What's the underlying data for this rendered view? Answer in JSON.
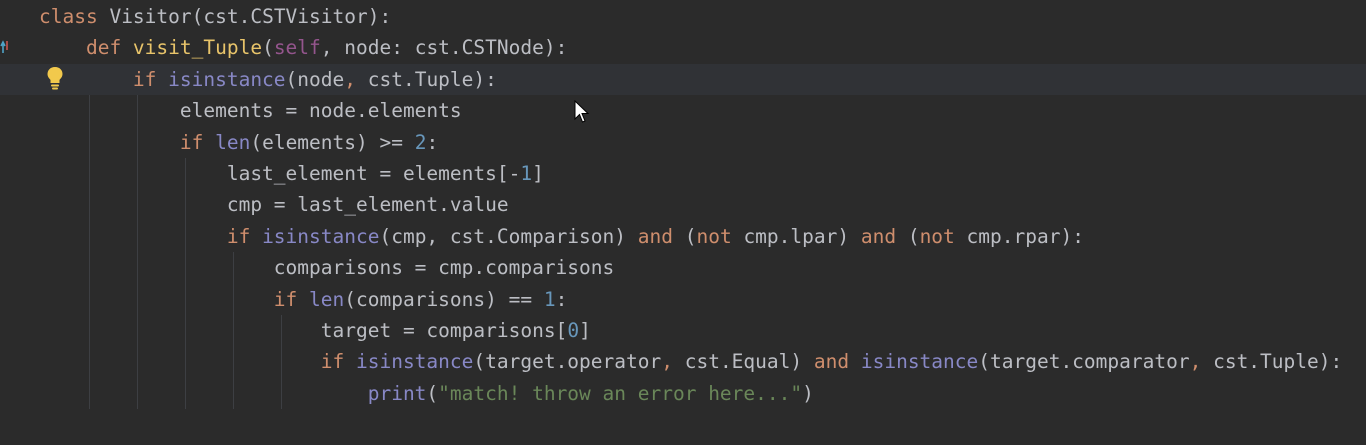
{
  "code": {
    "lines": [
      [
        {
          "t": "class ",
          "c": "kw"
        },
        {
          "t": "Visitor(cst.CSTVisitor):",
          "c": "txt"
        }
      ],
      [
        {
          "t": "    def ",
          "c": "kw"
        },
        {
          "t": "visit_Tuple",
          "c": "fn"
        },
        {
          "t": "(",
          "c": "txt"
        },
        {
          "t": "self",
          "c": "self"
        },
        {
          "t": ", node: cst.CSTNode):",
          "c": "txt"
        }
      ],
      [
        {
          "t": "        if ",
          "c": "kw"
        },
        {
          "t": "isinstance",
          "c": "bi"
        },
        {
          "t": "(node",
          "c": "txt"
        },
        {
          "t": ",",
          "c": "kw"
        },
        {
          "t": " cst.Tuple):",
          "c": "txt"
        }
      ],
      [
        {
          "t": "            elements = node.elements",
          "c": "txt"
        }
      ],
      [
        {
          "t": "            if ",
          "c": "kw"
        },
        {
          "t": "len",
          "c": "bi"
        },
        {
          "t": "(elements) >= ",
          "c": "txt"
        },
        {
          "t": "2",
          "c": "num"
        },
        {
          "t": ":",
          "c": "txt"
        }
      ],
      [
        {
          "t": "                last_element = elements[-",
          "c": "txt"
        },
        {
          "t": "1",
          "c": "num"
        },
        {
          "t": "]",
          "c": "txt"
        }
      ],
      [
        {
          "t": "                cmp = last_element.value",
          "c": "txt"
        }
      ],
      [
        {
          "t": "                if ",
          "c": "kw"
        },
        {
          "t": "isinstance",
          "c": "bi"
        },
        {
          "t": "(cmp, cst.Comparison) ",
          "c": "txt"
        },
        {
          "t": "and",
          "c": "kw"
        },
        {
          "t": " (",
          "c": "txt"
        },
        {
          "t": "not",
          "c": "kw"
        },
        {
          "t": " cmp.lpar) ",
          "c": "txt"
        },
        {
          "t": "and",
          "c": "kw"
        },
        {
          "t": " (",
          "c": "txt"
        },
        {
          "t": "not",
          "c": "kw"
        },
        {
          "t": " cmp.rpar):",
          "c": "txt"
        }
      ],
      [
        {
          "t": "                    comparisons = cmp.comparisons",
          "c": "txt"
        }
      ],
      [
        {
          "t": "                    if ",
          "c": "kw"
        },
        {
          "t": "len",
          "c": "bi"
        },
        {
          "t": "(comparisons) == ",
          "c": "txt"
        },
        {
          "t": "1",
          "c": "num"
        },
        {
          "t": ":",
          "c": "txt"
        }
      ],
      [
        {
          "t": "                        target = comparisons[",
          "c": "txt"
        },
        {
          "t": "0",
          "c": "num"
        },
        {
          "t": "]",
          "c": "txt"
        }
      ],
      [
        {
          "t": "                        if ",
          "c": "kw"
        },
        {
          "t": "isinstance",
          "c": "bi"
        },
        {
          "t": "(target.operator",
          "c": "txt"
        },
        {
          "t": ",",
          "c": "kw"
        },
        {
          "t": " cst.Equal) ",
          "c": "txt"
        },
        {
          "t": "and",
          "c": "kw"
        },
        {
          "t": " ",
          "c": "txt"
        },
        {
          "t": "isinstance",
          "c": "bi"
        },
        {
          "t": "(target.comparator",
          "c": "txt"
        },
        {
          "t": ",",
          "c": "kw"
        },
        {
          "t": " cst.Tuple):",
          "c": "txt"
        }
      ],
      [
        {
          "t": "                            print",
          "c": "bi"
        },
        {
          "t": "(",
          "c": "txt"
        },
        {
          "t": "\"match! throw an error here...\"",
          "c": "str"
        },
        {
          "t": ")",
          "c": "txt"
        }
      ]
    ],
    "current_line_index": 2
  },
  "gutter": {
    "override_marker_icon": "override-method-arrow-icon",
    "intention_icon": "lightbulb-icon"
  },
  "pointer": {
    "icon": "mouse-pointer-icon"
  },
  "colors": {
    "background": "#2b2b2b",
    "keyword": "#cf8e6d",
    "function_name": "#e8c46a",
    "builtin": "#8888c6",
    "self": "#94558d",
    "number": "#6897bb",
    "string": "#6a8759",
    "text": "#bcbec4"
  }
}
